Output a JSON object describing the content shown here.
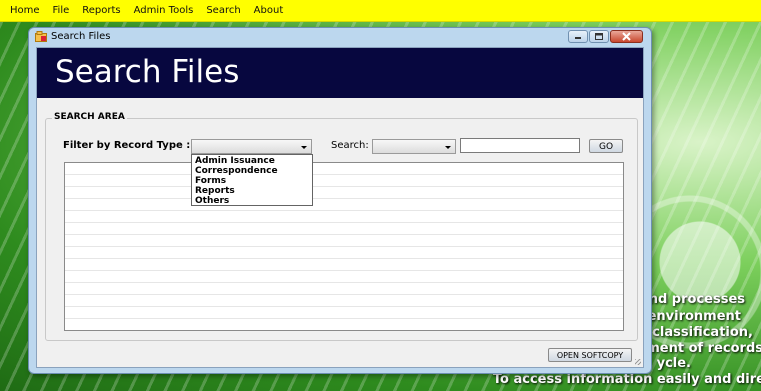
{
  "menu": [
    "Home",
    "File",
    "Reports",
    "Admin Tools",
    "Search",
    "About"
  ],
  "background": {
    "lines": [
      "and processes",
      "environment",
      ", classification,",
      "ement of records",
      "ycle.",
      "To access information easily and dire"
    ]
  },
  "window": {
    "title": "Search Files",
    "banner_title": "Search Files",
    "search_area": {
      "legend": "SEARCH AREA",
      "filter_label": "Filter by Record Type :",
      "search_label": "Search:",
      "go_label": "GO",
      "record_type_value": "",
      "search_combo_value": "",
      "search_text_value": "",
      "record_type_options": [
        "Admin Issuance",
        "Correspondence",
        "Forms",
        "Reports",
        "Others"
      ]
    },
    "open_softcopy_label": "OPEN SOFTCOPY"
  },
  "colors": {
    "menubar": "#ffff00",
    "banner": "#07073f",
    "window_frame": "#bcd7ee",
    "background_green": "#2e8b1e"
  }
}
